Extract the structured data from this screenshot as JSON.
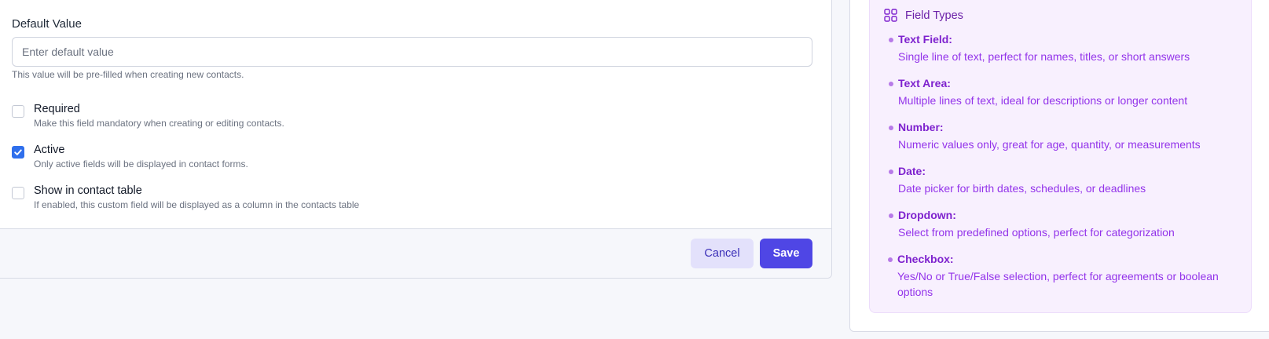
{
  "form": {
    "default_value": {
      "label": "Default Value",
      "placeholder": "Enter default value",
      "value": "",
      "help": "This value will be pre-filled when creating new contacts."
    },
    "checkboxes": [
      {
        "title": "Required",
        "description": "Make this field mandatory when creating or editing contacts.",
        "checked": false
      },
      {
        "title": "Active",
        "description": "Only active fields will be displayed in contact forms.",
        "checked": true
      },
      {
        "title": "Show in contact table",
        "description": "If enabled, this custom field will be displayed as a column in the contacts table",
        "checked": false
      }
    ],
    "actions": {
      "cancel_label": "Cancel",
      "save_label": "Save"
    }
  },
  "colors": {
    "primary": "#4f46e5",
    "checkbox_checked": "#2f6fec",
    "info_bg": "#f8f0fe",
    "info_text": "#9333ea"
  },
  "sidebar": {
    "title": "Field Types",
    "icon": "grid-icon",
    "types": [
      {
        "name": "Text Field:",
        "description": "Single line of text, perfect for names, titles, or short answers"
      },
      {
        "name": "Text Area:",
        "description": "Multiple lines of text, ideal for descriptions or longer content"
      },
      {
        "name": "Number:",
        "description": "Numeric values only, great for age, quantity, or measurements"
      },
      {
        "name": "Date:",
        "description": "Date picker for birth dates, schedules, or deadlines"
      },
      {
        "name": "Dropdown:",
        "description": "Select from predefined options, perfect for categorization"
      },
      {
        "name": "Checkbox:",
        "description": "Yes/No or True/False selection, perfect for agreements or boolean options"
      }
    ]
  }
}
